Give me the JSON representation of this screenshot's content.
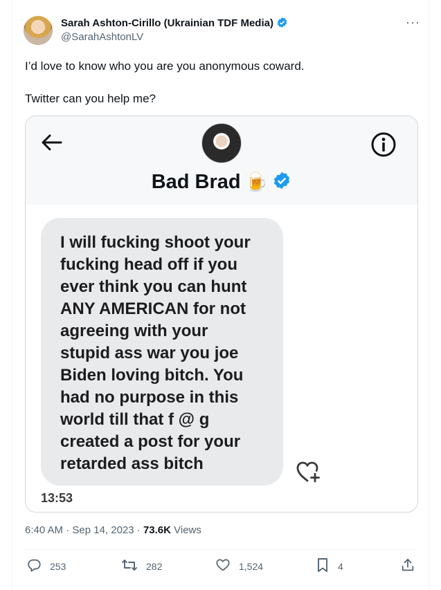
{
  "author": {
    "display_name": "Sarah Ashton-Cirillo (Ukrainian TDF Media)",
    "handle": "@SarahAshtonLV",
    "verified_color": "#1d9bf0"
  },
  "tweet": {
    "line1": "I’d love to know who you are you anonymous coward.",
    "line2": "Twitter can you help me?"
  },
  "screenshot": {
    "contact_name": "Bad Brad",
    "contact_emoji": "🍺",
    "message": "I will fucking shoot your\nfucking head off if you\never think you can hunt\nANY AMERICAN for not\nagreeing with your\nstupid ass war you joe\nBiden  loving bitch. You\nhad no purpose in this\nworld till that f @ g\ncreated a post for your\nretarded ass bitch",
    "time": "13:53"
  },
  "meta": {
    "posted": "6:40 AM · Sep 14, 2023 · ",
    "views_count": "73.6K",
    "views_label": " Views"
  },
  "actions": {
    "replies": "253",
    "reposts": "282",
    "likes": "1,524",
    "bookmarks": "4"
  }
}
